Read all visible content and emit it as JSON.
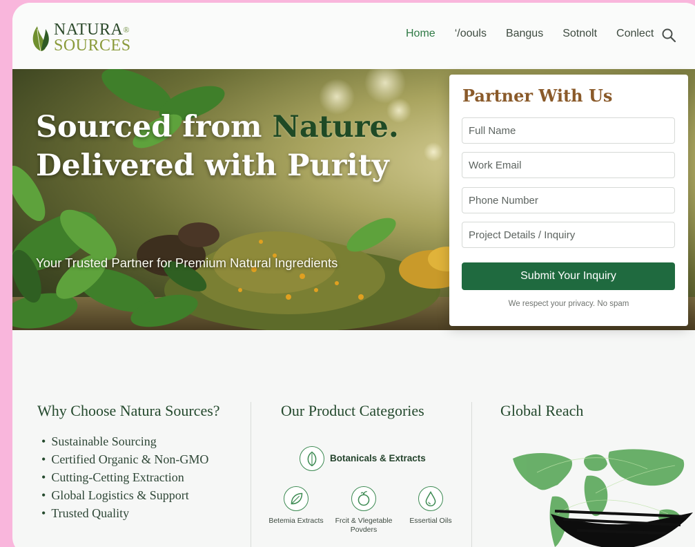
{
  "brand": {
    "line1": "NATURA",
    "line2": "SOURCES",
    "mark": "®"
  },
  "nav": {
    "items": [
      {
        "label": "Home",
        "active": true
      },
      {
        "label": "‘/oouls"
      },
      {
        "label": "Bangus"
      },
      {
        "label": "Sotnolt"
      },
      {
        "label": "Conlect"
      }
    ],
    "search_icon": "search-icon"
  },
  "hero": {
    "title_part1": "Sourced from ",
    "title_part2": "Nature.",
    "title_line2": "Delivered with Purity",
    "subtitle": "Your Trusted Partner for Premium Natural Ingredients"
  },
  "form": {
    "title": "Partner With Us",
    "fields": [
      {
        "placeholder": "Full Name"
      },
      {
        "placeholder": "Work Email"
      },
      {
        "placeholder": "Phone Number"
      },
      {
        "placeholder": "Project Details / Inquiry"
      }
    ],
    "submit_label": "Submit Your Inquiry",
    "privacy": "We respect your privacy. No spam"
  },
  "why": {
    "title": "Why Choose Natura Sources?",
    "items": [
      "Sustainable Sourcing",
      "Certified Organic & Non-GMO",
      "Cutting-Cetting Extraction",
      "Global Logistics & Support",
      "Trusted Quality"
    ]
  },
  "categories": {
    "title": "Our Product Categories",
    "main": {
      "label": "Botanicals & Extracts",
      "icon": "leaf-icon"
    },
    "sub": [
      {
        "label": "Betemia Extracts",
        "icon": "leaf-icon"
      },
      {
        "label_line1": "Frcit & Vlegetable",
        "label_line2": "Povders",
        "icon": "fruit-icon"
      },
      {
        "label": "Essertial Oils",
        "icon": "oil-drop-icon"
      }
    ]
  },
  "global": {
    "title": "Global Reach"
  },
  "colors": {
    "brand_green": "#1f6a3f",
    "form_title": "#8a5a2a",
    "page_border": "#f9b6dc"
  }
}
